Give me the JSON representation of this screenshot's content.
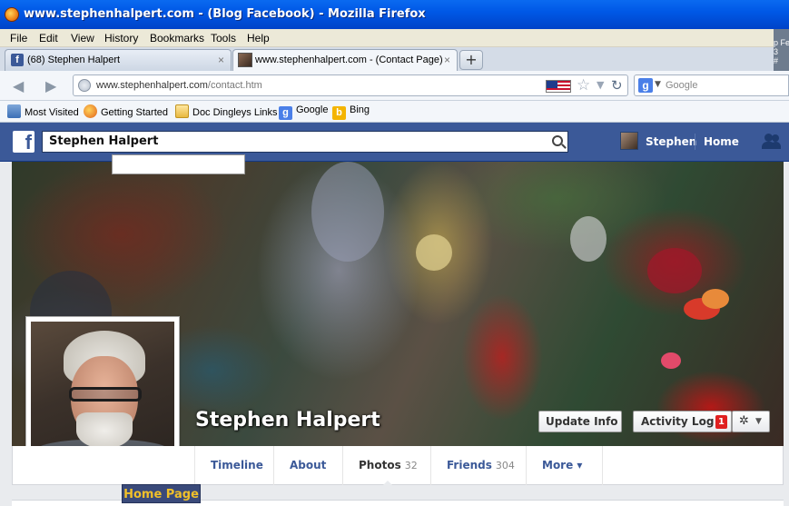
{
  "window": {
    "title": "www.stephenhalpert.com - (Blog Facebook) - Mozilla Firefox"
  },
  "menu": [
    "File",
    "Edit",
    "View",
    "History",
    "Bookmarks",
    "Tools",
    "Help"
  ],
  "stray_fragment": "p Fe\n3\n#",
  "tabs": [
    {
      "label": "(68) Stephen Halpert",
      "close": "×"
    },
    {
      "label": "www.stephenhalpert.com - (Contact Page)",
      "close": "×"
    }
  ],
  "newtab": "+",
  "nav": {
    "back": "◀",
    "forward": "▶",
    "url_host": "www.stephenhalpert.com",
    "url_path": "/contact.htm",
    "search_placeholder": "Google"
  },
  "bookmarks": [
    "Most Visited",
    "Getting Started",
    "Doc Dingleys Links",
    "Google",
    "Bing"
  ],
  "facebook": {
    "logo": "f",
    "search_value": "Stephen Halpert",
    "user_name": "Stephen",
    "home": "Home",
    "profile_name": "Stephen Halpert",
    "buttons": {
      "update_info": "Update Info",
      "activity_log": "Activity Log",
      "activity_badge": "1",
      "gear": "✲",
      "caret": "▼"
    },
    "nav_tabs": [
      {
        "label": "Timeline",
        "count": ""
      },
      {
        "label": "About",
        "count": ""
      },
      {
        "label": "Photos",
        "count": "32"
      },
      {
        "label": "Friends",
        "count": "304"
      },
      {
        "label": "More ▾",
        "count": ""
      }
    ]
  },
  "overlay_label": "Home Page",
  "colors": {
    "facebook_blue": "#3b5998",
    "badge_red": "#e02020",
    "overlay_gold": "#f0c02a"
  }
}
